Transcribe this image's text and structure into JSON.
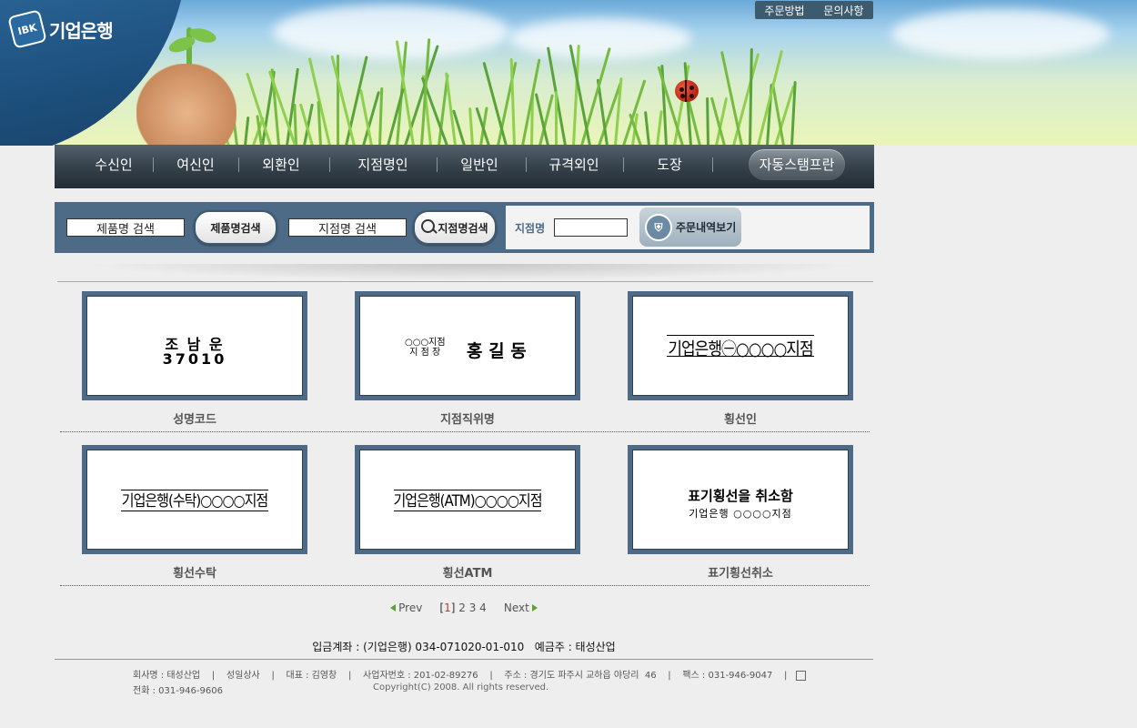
{
  "header": {
    "logo_mark": "IBK",
    "logo_text": "기업은행",
    "links": [
      "주문방법",
      "문의사항"
    ]
  },
  "nav": {
    "items": [
      "수신인",
      "여신인",
      "외환인",
      "지점명인",
      "일반인",
      "규격외인",
      "도장"
    ],
    "special": "자동스탬프란"
  },
  "search": {
    "product_placeholder": "제품명 검색",
    "product_button": "제품명검색",
    "branch_placeholder": "지점명 검색",
    "branch_button": "지점명검색",
    "branch_label": "지점명",
    "branch_value": "",
    "order_button": "주문내역보기"
  },
  "products": [
    {
      "label": "성명코드",
      "line1": "조 남 운",
      "line2": "37010"
    },
    {
      "label": "지점직위명",
      "small1": "○○○지점",
      "small2": "지 점 장",
      "big": "홍 길 동"
    },
    {
      "label": "횡선인",
      "text": "기업은행㊀○○○○지점"
    },
    {
      "label": "횡선수탁",
      "text": "기업은행(수탁)○○○○지점"
    },
    {
      "label": "횡선ATM",
      "text": "기업은행(ATM)○○○○지점"
    },
    {
      "label": "표기횡선취소",
      "line1": "표기횡선을 취소함",
      "line2": "기업은행  ○○○○지점"
    }
  ],
  "pager": {
    "prev": "Prev",
    "current": "1",
    "pages": "2 3 4",
    "next": "Next"
  },
  "footer": {
    "account": "입금계좌 : (기업은행) 034-071020-01-010   예금주 : 태성산업",
    "line1": "회사명 : 태성산업    |    성일상사    |    대표 : 김영창    |    사업자번호 : 201-02-89276    |    주소 : 경기도 파주시 교하읍 야당리  46    |    팩스 : 031-946-9047    |",
    "phone": "전화 : 031-946-9606",
    "copyright": "Copyright(C) 2008. All rights reserved."
  }
}
